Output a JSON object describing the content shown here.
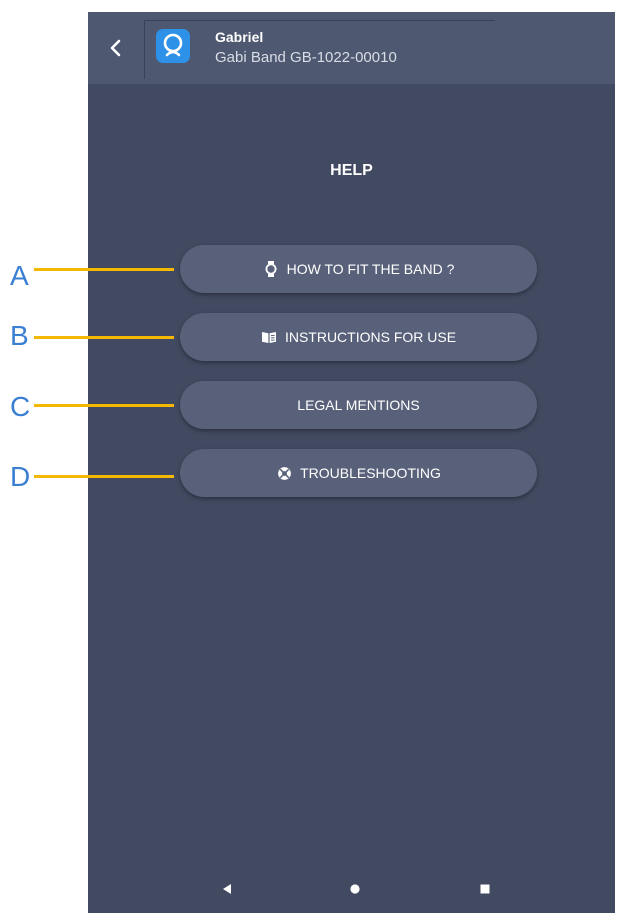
{
  "header": {
    "back_symbol": "‹",
    "user_name": "Gabriel",
    "device_name": "Gabi Band GB-1022-00010"
  },
  "page_title": "HELP",
  "menu": [
    {
      "label": "HOW TO FIT THE BAND ?",
      "icon": "watch-icon"
    },
    {
      "label": "INSTRUCTIONS FOR USE",
      "icon": "book-icon"
    },
    {
      "label": "LEGAL MENTIONS",
      "icon": ""
    },
    {
      "label": "TROUBLESHOOTING",
      "icon": "lifebuoy-icon"
    }
  ],
  "callouts": [
    "A",
    "B",
    "C",
    "D"
  ],
  "colors": {
    "background": "#424a61",
    "header": "#4f5871",
    "button": "#586179",
    "app_logo": "#2e91e8",
    "callout_text": "#3a7fd2",
    "callout_line": "#f5b800"
  }
}
